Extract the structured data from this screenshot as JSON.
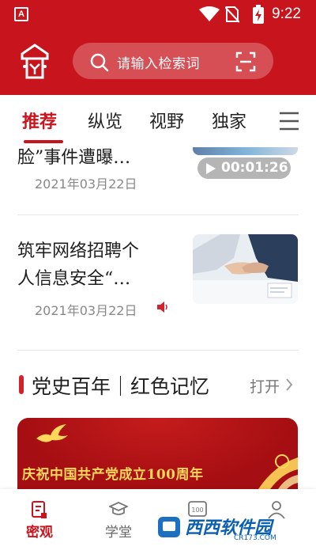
{
  "status_bar": {
    "app_icon_letter": "A",
    "time": "9:22"
  },
  "header": {
    "logo": "app-logo-seal",
    "search": {
      "placeholder": "请输入检索词",
      "icon": "search-icon",
      "scan_icon": "scan-icon"
    }
  },
  "tabs": {
    "items": [
      {
        "label": "推荐",
        "active": true
      },
      {
        "label": "纵览",
        "active": false
      },
      {
        "label": "视野",
        "active": false
      },
      {
        "label": "独家",
        "active": false
      }
    ],
    "menu_icon": "hamburger-icon"
  },
  "articles": [
    {
      "title_fragment": "脸”事件遭曝…",
      "date": "2021年03月22日",
      "duration": "00:01:26"
    },
    {
      "title_line1": "筑牢网络招聘个",
      "title_line2": "人信息安全“…",
      "date": "2021年03月22日",
      "audio_icon": "speaker-icon"
    }
  ],
  "section": {
    "title": "党史百年｜红色记忆",
    "more_label": "打开"
  },
  "banner": {
    "text": "庆祝中国共产党成立100周年"
  },
  "bottom_nav": {
    "items": [
      {
        "label": "密观",
        "active": true,
        "icon": "document-icon"
      },
      {
        "label": "学堂",
        "active": false,
        "icon": "graduation-cap-icon"
      },
      {
        "label": "",
        "active": false,
        "icon": "badge-100-icon"
      },
      {
        "label": "",
        "active": false,
        "icon": "person-icon"
      }
    ]
  },
  "watermark": {
    "text": "西西软件园",
    "sub": "CR173.COM"
  },
  "colors": {
    "brand_red": "#c8151d",
    "banner_gold": "#ffd75a",
    "text_dark": "#1e1e1e",
    "text_gray": "#888888"
  }
}
